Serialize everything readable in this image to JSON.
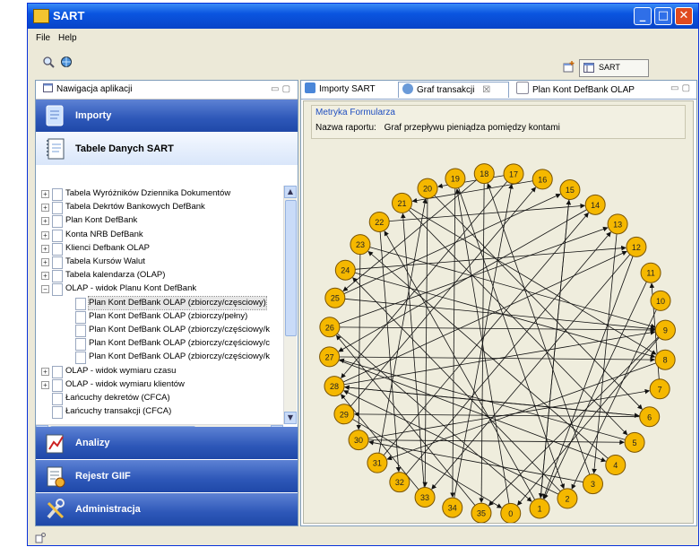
{
  "window": {
    "title": "SART",
    "buttons": {
      "minimize": "_",
      "maximize": "□",
      "close": "✕"
    }
  },
  "menu": {
    "file": "File",
    "help": "Help"
  },
  "perspective": {
    "label": "SART"
  },
  "left_panel": {
    "title": "Nawigacja aplikacji",
    "min_max": "▭ ▢",
    "bars": {
      "importy": "Importy",
      "tabele": "Tabele Danych SART",
      "analizy": "Analizy",
      "rejestr": "Rejestr GIIF",
      "administracja": "Administracja"
    },
    "tree": [
      {
        "label": "Tabela Wyróżników Dziennika Dokumentów",
        "level": 0,
        "expander": "+",
        "selected": false
      },
      {
        "label": "Tabela Dekrtów Bankowych DefBank",
        "level": 0,
        "expander": "+",
        "selected": false
      },
      {
        "label": "Plan Kont DefBank",
        "level": 0,
        "expander": "+",
        "selected": false
      },
      {
        "label": "Konta NRB DefBank",
        "level": 0,
        "expander": "+",
        "selected": false
      },
      {
        "label": "Klienci Defbank OLAP",
        "level": 0,
        "expander": "+",
        "selected": false
      },
      {
        "label": "Tabela Kursów Walut",
        "level": 0,
        "expander": "+",
        "selected": false
      },
      {
        "label": "Tabela kalendarza (OLAP)",
        "level": 0,
        "expander": "+",
        "selected": false
      },
      {
        "label": "OLAP - widok Planu Kont DefBank",
        "level": 0,
        "expander": "−",
        "selected": false
      },
      {
        "label": "Plan Kont DefBank OLAP (zbiorczy/częsciowy)",
        "level": 1,
        "expander": "",
        "selected": true
      },
      {
        "label": "Plan Kont DefBank OLAP (zbiorczy/pełny)",
        "level": 1,
        "expander": "",
        "selected": false
      },
      {
        "label": "Plan Kont DefBank OLAP (zbiorczy/częściowy/k",
        "level": 1,
        "expander": "",
        "selected": false
      },
      {
        "label": "Plan Kont DefBank OLAP (zbiorczy/częściowy/c",
        "level": 1,
        "expander": "",
        "selected": false
      },
      {
        "label": "Plan Kont DefBank OLAP (zbiorczy/częściowy/k",
        "level": 1,
        "expander": "",
        "selected": false
      },
      {
        "label": "OLAP - widok wymiaru czasu",
        "level": 0,
        "expander": "+",
        "selected": false
      },
      {
        "label": "OLAP - widok wymiaru klientów",
        "level": 0,
        "expander": "+",
        "selected": false
      },
      {
        "label": "Łańcuchy dekretów (CFCA)",
        "level": 0,
        "expander": "",
        "selected": false
      },
      {
        "label": "Łańcuchy transakcji (CFCA)",
        "level": 0,
        "expander": "",
        "selected": false
      }
    ]
  },
  "right_panel": {
    "tabs": [
      {
        "label": "Importy SART",
        "active": false
      },
      {
        "label": "Graf transakcji",
        "active": true,
        "close": "☒"
      },
      {
        "label": "Plan Kont DefBank OLAP",
        "active": false
      }
    ],
    "min_max": "▭ ▢",
    "metryka": {
      "header": "Metryka Formularza",
      "report_label": "Nazwa raportu:",
      "report_value": "Graf przepływu pieniądza pomiędzy kontami"
    }
  },
  "graph": {
    "node_color": "#f5b800",
    "node_border": "#7a5400",
    "nodes": [
      "0",
      "1",
      "2",
      "3",
      "4",
      "5",
      "6",
      "7",
      "8",
      "9",
      "10",
      "11",
      "12",
      "13",
      "14",
      "15",
      "16",
      "17",
      "18",
      "19",
      "20",
      "21",
      "22",
      "23",
      "24",
      "25",
      "26",
      "27",
      "28",
      "29",
      "30",
      "31",
      "32",
      "33",
      "34",
      "35"
    ],
    "edges": [
      [
        "16",
        "21"
      ],
      [
        "17",
        "20"
      ],
      [
        "18",
        "25"
      ],
      [
        "19",
        "34"
      ],
      [
        "20",
        "6"
      ],
      [
        "20",
        "33"
      ],
      [
        "21",
        "5"
      ],
      [
        "21",
        "8"
      ],
      [
        "22",
        "32"
      ],
      [
        "22",
        "14"
      ],
      [
        "23",
        "30"
      ],
      [
        "23",
        "9"
      ],
      [
        "24",
        "12"
      ],
      [
        "25",
        "15"
      ],
      [
        "25",
        "9"
      ],
      [
        "26",
        "13"
      ],
      [
        "26",
        "1"
      ],
      [
        "27",
        "8"
      ],
      [
        "27",
        "4"
      ],
      [
        "28",
        "9"
      ],
      [
        "28",
        "12"
      ],
      [
        "28",
        "6"
      ],
      [
        "29",
        "0"
      ],
      [
        "29",
        "16"
      ],
      [
        "30",
        "7"
      ],
      [
        "31",
        "20"
      ],
      [
        "31",
        "14"
      ],
      [
        "32",
        "13"
      ],
      [
        "33",
        "21"
      ],
      [
        "34",
        "17"
      ],
      [
        "35",
        "26"
      ],
      [
        "0",
        "19"
      ],
      [
        "1",
        "22"
      ],
      [
        "1",
        "15"
      ],
      [
        "2",
        "24"
      ],
      [
        "2",
        "28"
      ],
      [
        "3",
        "18"
      ],
      [
        "4",
        "23"
      ],
      [
        "5",
        "27"
      ],
      [
        "6",
        "29"
      ],
      [
        "7",
        "11"
      ],
      [
        "8",
        "31"
      ],
      [
        "9",
        "35"
      ],
      [
        "9",
        "0"
      ],
      [
        "10",
        "2"
      ],
      [
        "11",
        "1"
      ],
      [
        "12",
        "33"
      ],
      [
        "13",
        "3"
      ],
      [
        "14",
        "27"
      ],
      [
        "15",
        "1"
      ],
      [
        "17",
        "28"
      ],
      [
        "24",
        "8"
      ],
      [
        "26",
        "9"
      ],
      [
        "30",
        "5"
      ],
      [
        "33",
        "28"
      ],
      [
        "12",
        "1"
      ],
      [
        "19",
        "2"
      ],
      [
        "18",
        "35"
      ],
      [
        "6",
        "28"
      ],
      [
        "3",
        "30"
      ]
    ]
  }
}
